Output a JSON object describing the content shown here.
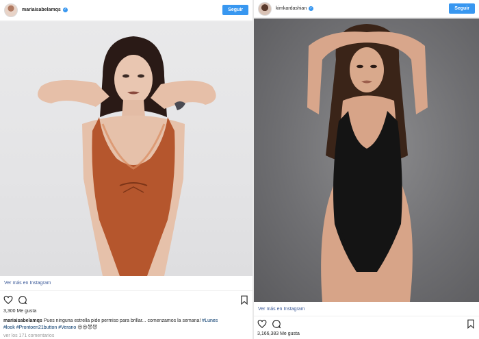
{
  "left_post": {
    "username": "mariaisabelamqs",
    "follow_label": "Seguir",
    "view_more": "Ver más en Instagram",
    "likes": "3,300 Me gusta",
    "caption_user": "mariaisabelamqs",
    "caption_text": "Pues ninguna estrella pide permiso para brillar... comenzamos la semana!",
    "hashtags": [
      "#Lunes",
      "#look",
      "#Prontoen21button",
      "#Verano"
    ],
    "caption_emoji": "😍😍😈😈",
    "comments_link": "ver los 171 comentarios"
  },
  "right_post": {
    "username": "kimkardashian",
    "follow_label": "Seguir",
    "view_more": "Ver más en Instagram",
    "likes": "3,166,383 Me gusta"
  },
  "colors": {
    "accent": "#3897f0",
    "link": "#3b5998",
    "left_swimsuit": "#b5562d",
    "right_swimsuit": "#141414"
  },
  "icons": [
    "heart-icon",
    "comment-icon",
    "bookmark-icon",
    "verified-badge-icon"
  ]
}
